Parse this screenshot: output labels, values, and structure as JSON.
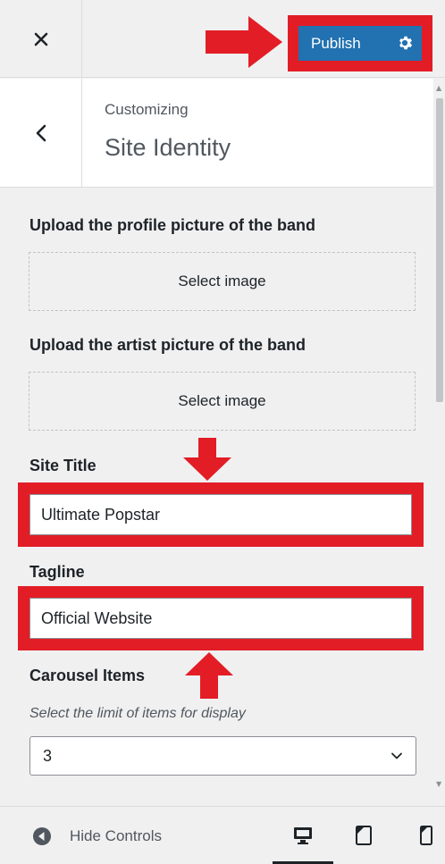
{
  "header": {
    "close_icon": "close-icon",
    "publish_label": "Publish",
    "publish_settings_icon": "gear-icon"
  },
  "section": {
    "back_icon": "chevron-left-icon",
    "breadcrumb": "Customizing",
    "title": "Site Identity"
  },
  "controls": {
    "profile_picture": {
      "label": "Upload the profile picture of the band",
      "button": "Select image"
    },
    "artist_picture": {
      "label": "Upload the artist picture of the band",
      "button": "Select image"
    },
    "site_title": {
      "label": "Site Title",
      "value": "Ultimate Popstar"
    },
    "tagline": {
      "label": "Tagline",
      "value": "Official Website"
    },
    "carousel": {
      "label": "Carousel Items",
      "description": "Select the limit of items for display",
      "selected": "3"
    }
  },
  "footer": {
    "hide_controls_label": "Hide Controls",
    "devices": [
      "desktop-icon",
      "tablet-icon",
      "mobile-icon"
    ]
  },
  "colors": {
    "annotation_red": "#e21d26",
    "publish_blue": "#2271b1"
  }
}
